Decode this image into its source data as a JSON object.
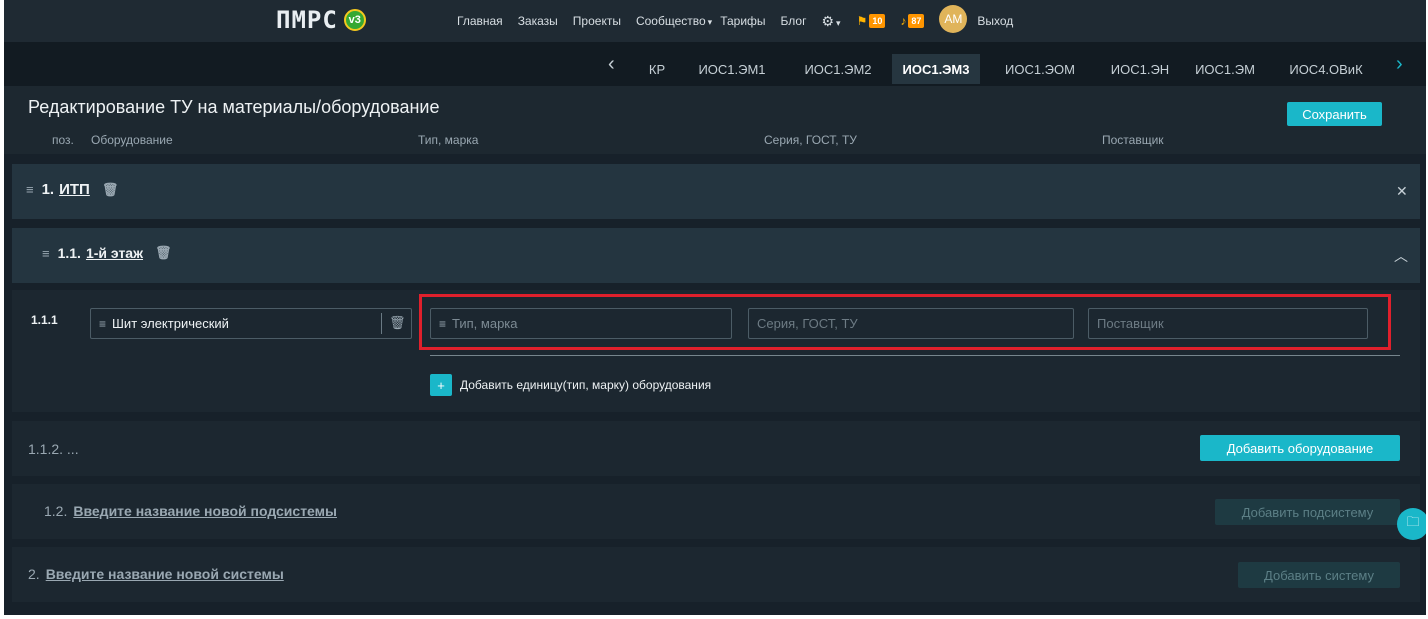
{
  "logo": {
    "text": "ПМРС",
    "badge": "v3"
  },
  "nav": {
    "links": [
      "Главная",
      "Заказы",
      "Проекты"
    ],
    "community": "Сообщество",
    "tariffs": "Тарифы",
    "blog": "Блог",
    "messages_count": "10",
    "notifications_count": "87",
    "avatar_initials": "АМ",
    "logout": "Выход"
  },
  "tabs": [
    "КР",
    "ИОС1.ЭМ1",
    "ИОС1.ЭМ2",
    "ИОС1.ЭМ3",
    "ИОС1.ЭОМ",
    "ИОС1.ЭН",
    "ИОС1.ЭМ",
    "ИОС4.ОВиК"
  ],
  "active_tab": "ИОС1.ЭМ3",
  "header": {
    "title": "Редактирование ТУ на материалы/оборудование",
    "save_label": "Сохранить",
    "columns": {
      "pos": "поз.",
      "equipment": "Оборудование",
      "type": "Тип, марка",
      "series": "Серия, ГОСТ, ТУ",
      "supplier": "Поставщик"
    }
  },
  "system1": {
    "num": "1.",
    "name": "ИТП"
  },
  "subsystem": {
    "num": "1.1.",
    "name": "1-й этаж"
  },
  "item": {
    "pos": "1.1.1",
    "equipment_value": "Шит электрический",
    "type_placeholder": "Тип, марка",
    "series_placeholder": "Серия, ГОСТ, ТУ",
    "supplier_placeholder": "Поставщик",
    "add_unit_label": "Добавить единицу(тип, марку) оборудования"
  },
  "new_item": {
    "pos": "1.1.2. ...",
    "add_label": "Добавить оборудование"
  },
  "new_subsystem": {
    "num": "1.2.",
    "name": "Введите название новой подсистемы",
    "add_label": "Добавить подсистему"
  },
  "new_system": {
    "num": "2.",
    "name": "Введите название новой системы",
    "add_label": "Добавить систему"
  },
  "colors": {
    "accent": "#1ab7c9",
    "highlight_border": "#e0202c"
  }
}
